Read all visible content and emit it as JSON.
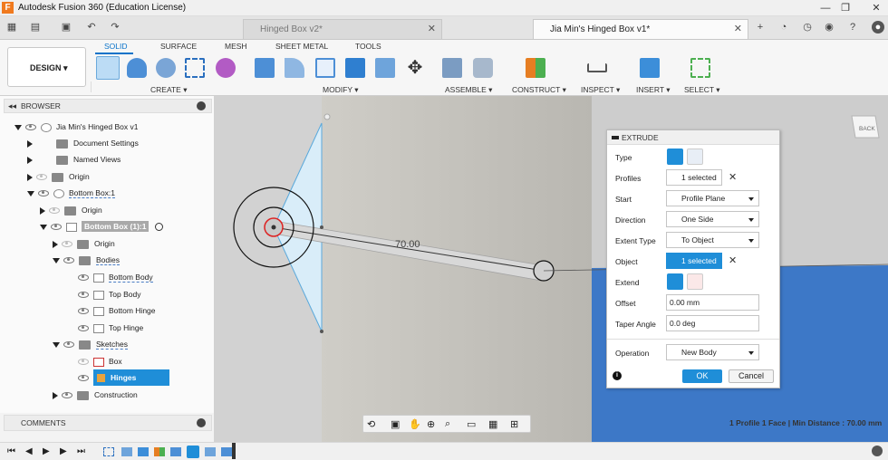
{
  "window": {
    "title": "Autodesk Fusion 360 (Education License)",
    "app_icon": "F",
    "controls": [
      "—",
      "❐",
      "✕"
    ]
  },
  "tabs": [
    {
      "label": "Hinged Box v2*",
      "close": "✕"
    },
    {
      "label": "Jia Min's Hinged Box v1*",
      "close": "✕"
    }
  ],
  "workspace": {
    "label": "DESIGN ▾"
  },
  "toolbar": {
    "categories": [
      "SOLID",
      "SURFACE",
      "MESH",
      "SHEET METAL",
      "TOOLS"
    ],
    "groups": [
      "CREATE ▾",
      "MODIFY ▾",
      "ASSEMBLE ▾",
      "CONSTRUCT ▾",
      "INSPECT ▾",
      "INSERT ▾",
      "SELECT ▾"
    ]
  },
  "browser": {
    "title": "BROWSER",
    "items": [
      {
        "label": "Jia Min's Hinged Box v1"
      },
      {
        "label": "Document Settings"
      },
      {
        "label": "Named Views"
      },
      {
        "label": "Origin"
      },
      {
        "label": "Bottom Box:1"
      },
      {
        "label": "Origin"
      },
      {
        "label": "Bottom Box (1):1"
      },
      {
        "label": "Origin"
      },
      {
        "label": "Bodies"
      },
      {
        "label": "Bottom Body"
      },
      {
        "label": "Top Body"
      },
      {
        "label": "Bottom Hinge"
      },
      {
        "label": "Top Hinge"
      },
      {
        "label": "Sketches"
      },
      {
        "label": "Box"
      },
      {
        "label": "Hinges"
      },
      {
        "label": "Construction"
      }
    ]
  },
  "comments": {
    "label": "COMMENTS"
  },
  "viewcube": {
    "label": "BACK"
  },
  "canvas": {
    "dimension": "70.00",
    "status": "1 Profile 1 Face | Min Distance : 70.00 mm"
  },
  "extrude": {
    "title": "EXTRUDE",
    "labels": {
      "type": "Type",
      "profiles": "Profiles",
      "start": "Start",
      "direction": "Direction",
      "extent_type": "Extent Type",
      "object": "Object",
      "extend": "Extend",
      "offset": "Offset",
      "taper": "Taper Angle",
      "operation": "Operation"
    },
    "profiles": "1 selected",
    "start": "Profile Plane",
    "direction": "One Side",
    "extent_type": "To Object",
    "object": "1 selected",
    "offset": "0.00 mm",
    "taper": "0.0 deg",
    "operation": "New Body",
    "ok": "OK",
    "cancel": "Cancel",
    "clear": "✕",
    "info": "i"
  },
  "colors": {
    "accent": "#1f8ed8",
    "blue_face": "#3d78c7"
  }
}
